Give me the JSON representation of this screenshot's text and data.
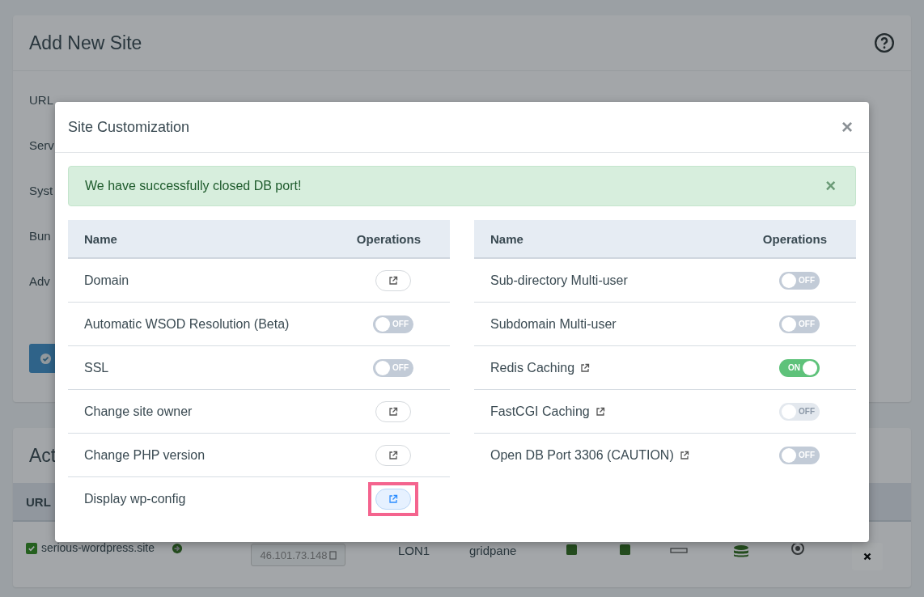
{
  "page": {
    "title": "Add New Site",
    "form_labels": [
      "URL",
      "Serv",
      "Syst",
      "Bun",
      "Adv"
    ],
    "sites_title": "Act",
    "sites_table": {
      "columns": [
        "URL"
      ],
      "row": {
        "url": "serious-wordpress.site",
        "checked": true,
        "ip": "46.101.73.148",
        "location": "LON1",
        "owner": "gridpane"
      }
    }
  },
  "modal": {
    "title": "Site Customization",
    "close": "×",
    "alert": {
      "message": "We have successfully closed DB port!",
      "close": "×"
    },
    "tables": [
      {
        "columns": [
          "Name",
          "Operations"
        ],
        "rows": [
          {
            "name": "Domain",
            "external": false,
            "kind": "link",
            "highlighted": false
          },
          {
            "name": "Automatic WSOD Resolution (Beta)",
            "external": false,
            "kind": "toggle",
            "on": false,
            "disabled": false,
            "label": "OFF"
          },
          {
            "name": "SSL",
            "external": false,
            "kind": "toggle",
            "on": false,
            "disabled": false,
            "label": "OFF"
          },
          {
            "name": "Change site owner",
            "external": false,
            "kind": "link",
            "highlighted": false
          },
          {
            "name": "Change PHP version",
            "external": false,
            "kind": "link",
            "highlighted": false
          },
          {
            "name": "Display wp-config",
            "external": false,
            "kind": "link",
            "highlighted": true
          }
        ]
      },
      {
        "columns": [
          "Name",
          "Operations"
        ],
        "rows": [
          {
            "name": "Sub-directory Multi-user",
            "external": false,
            "kind": "toggle",
            "on": false,
            "disabled": false,
            "label": "OFF"
          },
          {
            "name": "Subdomain Multi-user",
            "external": false,
            "kind": "toggle",
            "on": false,
            "disabled": false,
            "label": "OFF"
          },
          {
            "name": "Redis Caching",
            "external": true,
            "kind": "toggle",
            "on": true,
            "disabled": false,
            "label": "ON"
          },
          {
            "name": "FastCGI Caching",
            "external": true,
            "kind": "toggle",
            "on": false,
            "disabled": true,
            "label": "OFF"
          },
          {
            "name": "Open DB Port 3306 (CAUTION)",
            "external": true,
            "kind": "toggle",
            "on": false,
            "disabled": false,
            "label": "OFF"
          }
        ]
      }
    ]
  }
}
